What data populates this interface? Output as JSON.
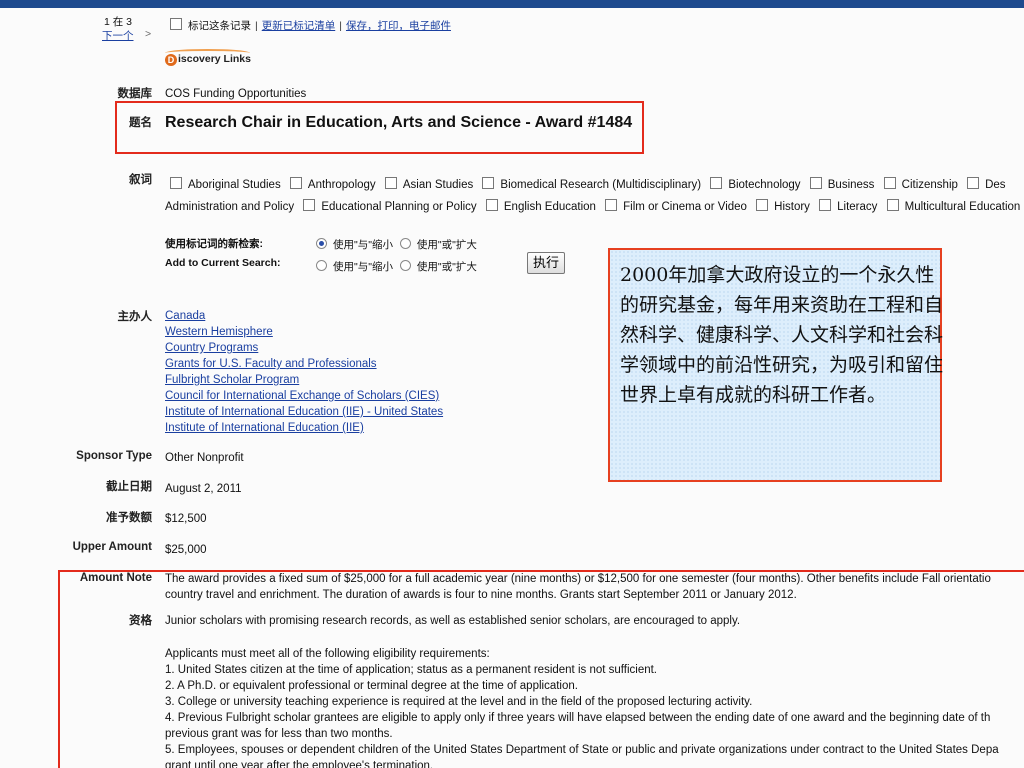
{
  "nav": {
    "record_position": "1 在 3",
    "next_link": "下一个",
    "next_arrow": ">",
    "mark_record": "标记这条记录",
    "update_marked_list": "更新已标记清单",
    "save_print_email": "保存，打印，电子邮件",
    "separator": "|"
  },
  "logo": {
    "text": "iscovery Links",
    "initial": "D"
  },
  "fields": {
    "database_label": "数据库",
    "database_value": "COS Funding Opportunities",
    "title_label": "题名",
    "title_value": "Research Chair in Education, Arts and Science - Award #1484",
    "descriptors_label": "叙词",
    "descriptors_row1": [
      "Aboriginal Studies",
      "Anthropology",
      "Asian Studies",
      "Biomedical Research (Multidisciplinary)",
      "Biotechnology",
      "Business",
      "Citizenship",
      "Des"
    ],
    "descriptors_row1_lead": "",
    "descriptors_row2_lead": "Administration and Policy",
    "descriptors_row2": [
      "Educational Planning or Policy",
      "English Education",
      "Film or Cinema or Video",
      "History",
      "Literacy",
      "Multicultural Education"
    ],
    "search_label_cn": "使用标记词的新检索:",
    "search_label_en": "Add to Current Search:",
    "and_narrow": "使用\"与\"缩小",
    "or_broaden": "使用\"或\"扩大",
    "execute_button": "执行",
    "sponsor_label": "主办人",
    "sponsors": [
      "Canada",
      "Western Hemisphere",
      "Country Programs",
      "Grants for U.S. Faculty and Professionals",
      "Fulbright Scholar Program",
      "Council for International Exchange of Scholars (CIES)",
      "Institute of International Education (IIE) - United States",
      "Institute of International Education (IIE)"
    ],
    "sponsor_type_label": "Sponsor Type",
    "sponsor_type_value": "Other Nonprofit",
    "deadline_label": "截止日期",
    "deadline_value": "August 2, 2011",
    "amount_label": "准予数额",
    "amount_value": "$12,500",
    "upper_amount_label": "Upper Amount",
    "upper_amount_value": "$25,000",
    "amount_note_label": "Amount Note",
    "amount_note_line1": "The award provides a fixed sum of $25,000 for a full academic year (nine months) or $12,500 for one semester (four months). Other benefits include Fall orientatio",
    "amount_note_line2": "country travel and enrichment. The duration of awards is four to nine months. Grants start September 2011 or January 2012.",
    "eligibility_label": "资格",
    "eligibility_intro": "Junior scholars with promising research records, as well as established senior scholars, are encouraged to apply.",
    "eligibility_req_heading": "Applicants must meet all of the following eligibility requirements:",
    "eligibility_items": [
      "1. United States citizen at the time of application; status as a permanent resident is not sufficient.",
      "2. A Ph.D. or equivalent professional or terminal degree at the time of application.",
      "3. College or university teaching experience is required at the level and in the field of the proposed lecturing activity.",
      "4. Previous Fulbright scholar grantees are eligible to apply only if three years will have elapsed between the ending date of one award and the beginning date of th",
      "previous grant was for less than two months.",
      "5. Employees, spouses or dependent children of the United States Department of State or public and private organizations under contract to the United States Depa",
      "grant until one year after the employee's termination."
    ]
  },
  "callout": {
    "text": "2000年加拿大政府设立的一个永久性的研究基金，每年用来资助在工程和自然科学、健康科学、人文科学和社会科学领域中的前沿性研究，为吸引和留住世界上卓有成就的科研工作者。"
  },
  "colors": {
    "frame_blue": "#1e4a8e",
    "highlight_red": "#e32b1c",
    "link_blue": "#1a3fa0",
    "callout_bg": "#ddeefc"
  }
}
